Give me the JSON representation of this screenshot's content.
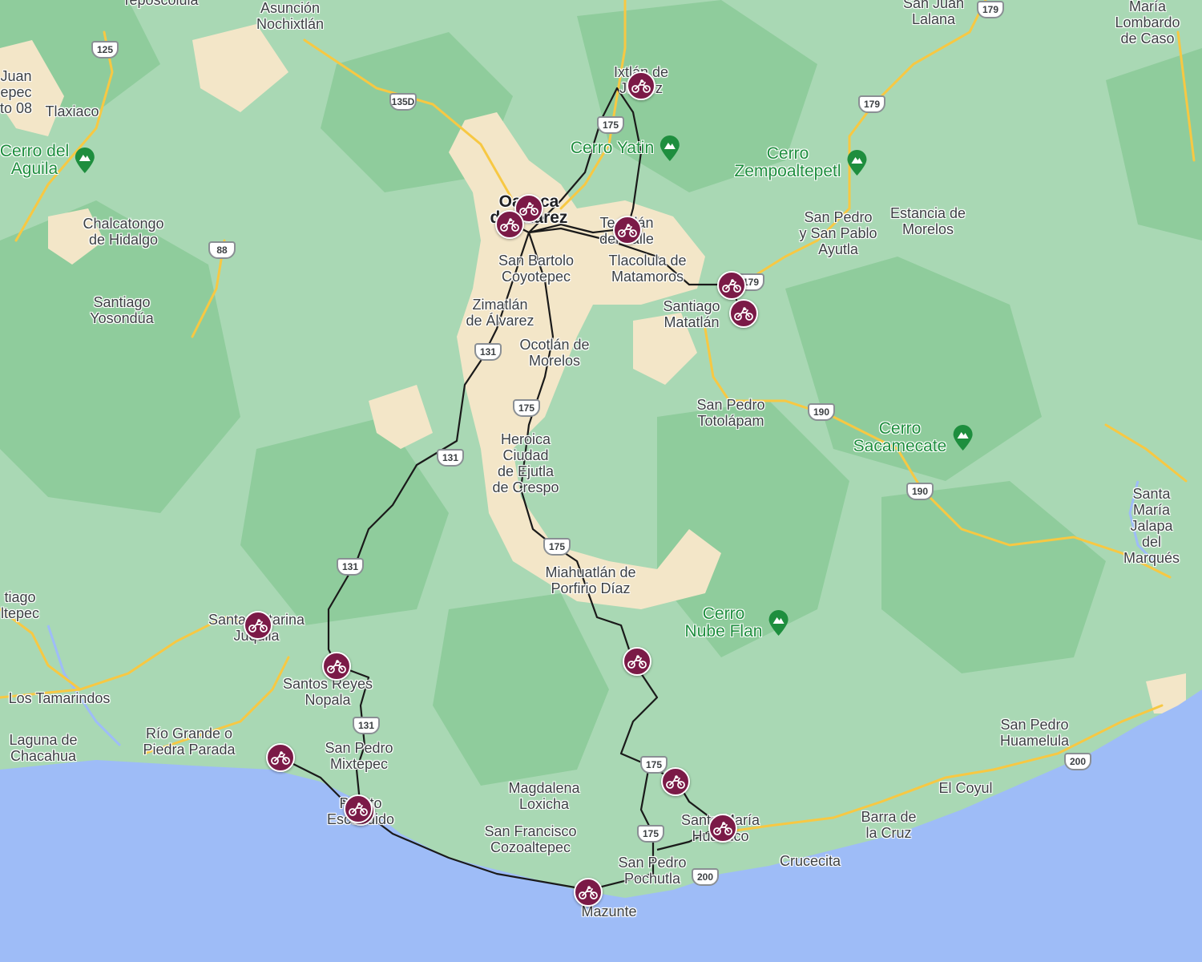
{
  "colors": {
    "water": "#9ebcf7",
    "land": "#a9d8b4",
    "forest": "#8fcc9c",
    "urban": "#f3e6c8",
    "road": "#f7c843",
    "route": "#1a1a1a",
    "pin": "#7b1a47",
    "peak": "#1e8e3e"
  },
  "places": [
    {
      "name": "Teposcolula",
      "cls": ""
    },
    {
      "name": "Asunción\nNochixtlán",
      "cls": ""
    },
    {
      "name": "San Juan\nLalana",
      "cls": ""
    },
    {
      "name": "María\nLombardo\nde Caso",
      "cls": ""
    },
    {
      "name": "Juan\nepec\nto 08",
      "cls": ""
    },
    {
      "name": "Tlaxiaco",
      "cls": ""
    },
    {
      "name": "Ixtlán de\nJuárez",
      "cls": ""
    },
    {
      "name": "Chalcatongo\nde Hidalgo",
      "cls": ""
    },
    {
      "name": "Oaxaca\nde Juárez",
      "cls": "city"
    },
    {
      "name": "Teotitlán\ndel Valle",
      "cls": ""
    },
    {
      "name": "San Pedro\ny San Pablo\nAyutla",
      "cls": ""
    },
    {
      "name": "Estancia de\nMorelos",
      "cls": ""
    },
    {
      "name": "San Bartolo\nCoyotepec",
      "cls": ""
    },
    {
      "name": "Tlacolula de\nMatamoros",
      "cls": ""
    },
    {
      "name": "Santiago\nYosondúa",
      "cls": ""
    },
    {
      "name": "Zimatlán\nde Álvarez",
      "cls": ""
    },
    {
      "name": "Santiago\nMatatlán",
      "cls": ""
    },
    {
      "name": "Ocotlán de\nMorelos",
      "cls": ""
    },
    {
      "name": "San Pedro\nTotolápam",
      "cls": ""
    },
    {
      "name": "Heroica\nCiudad\nde Ejutla\nde Crespo",
      "cls": ""
    },
    {
      "name": "Santa María\nJalapa del\nMarqués",
      "cls": ""
    },
    {
      "name": "Miahuatlán de\nPorfirio Díaz",
      "cls": ""
    },
    {
      "name": "tiago\nltepec",
      "cls": ""
    },
    {
      "name": "Santa Catarina\nJuquila",
      "cls": ""
    },
    {
      "name": "Santos Reyes\nNopala",
      "cls": ""
    },
    {
      "name": "Los Tamarindos",
      "cls": ""
    },
    {
      "name": "Río Grande o\nPiedra Parada",
      "cls": ""
    },
    {
      "name": "Laguna de\nChacahua",
      "cls": ""
    },
    {
      "name": "San Pedro\nMixtepec",
      "cls": ""
    },
    {
      "name": "San Pedro\nHuamelula",
      "cls": ""
    },
    {
      "name": "Magdalena\nLoxicha",
      "cls": ""
    },
    {
      "name": "El Coyul",
      "cls": ""
    },
    {
      "name": "Puerto\nEscondido",
      "cls": ""
    },
    {
      "name": "Santa María\nHuatulco",
      "cls": ""
    },
    {
      "name": "Barra de\nla Cruz",
      "cls": ""
    },
    {
      "name": "San Francisco\nCozoaltepec",
      "cls": ""
    },
    {
      "name": "San Pedro\nPochutla",
      "cls": ""
    },
    {
      "name": "Crucecita",
      "cls": ""
    },
    {
      "name": "Mazunte",
      "cls": ""
    }
  ],
  "peaks": [
    {
      "name": "Cerro Yatin"
    },
    {
      "name": "Cerro del\nAguila"
    },
    {
      "name": "Cerro\nZempoaltepetl"
    },
    {
      "name": "Cerro\nSacamecate"
    },
    {
      "name": "Cerro\nNube Flan"
    }
  ],
  "highways": [
    "125",
    "135D",
    "179",
    "179",
    "175",
    "179",
    "88",
    "131",
    "175",
    "190",
    "131",
    "190",
    "175",
    "131",
    "131",
    "175",
    "175",
    "200",
    "200"
  ],
  "stops": [
    {
      "icon": "motorcycle-icon"
    },
    {
      "icon": "motorcycle-icon"
    },
    {
      "icon": "motorcycle-icon"
    },
    {
      "icon": "motorcycle-icon"
    },
    {
      "icon": "motorcycle-icon"
    },
    {
      "icon": "motorcycle-icon"
    },
    {
      "icon": "motorcycle-icon"
    },
    {
      "icon": "motorcycle-icon"
    },
    {
      "icon": "motorcycle-icon"
    },
    {
      "icon": "motorcycle-icon"
    },
    {
      "icon": "motorcycle-icon"
    },
    {
      "icon": "motorcycle-icon"
    },
    {
      "icon": "motorcycle-icon"
    },
    {
      "icon": "motorcycle-icon"
    },
    {
      "icon": "motorcycle-icon"
    }
  ]
}
